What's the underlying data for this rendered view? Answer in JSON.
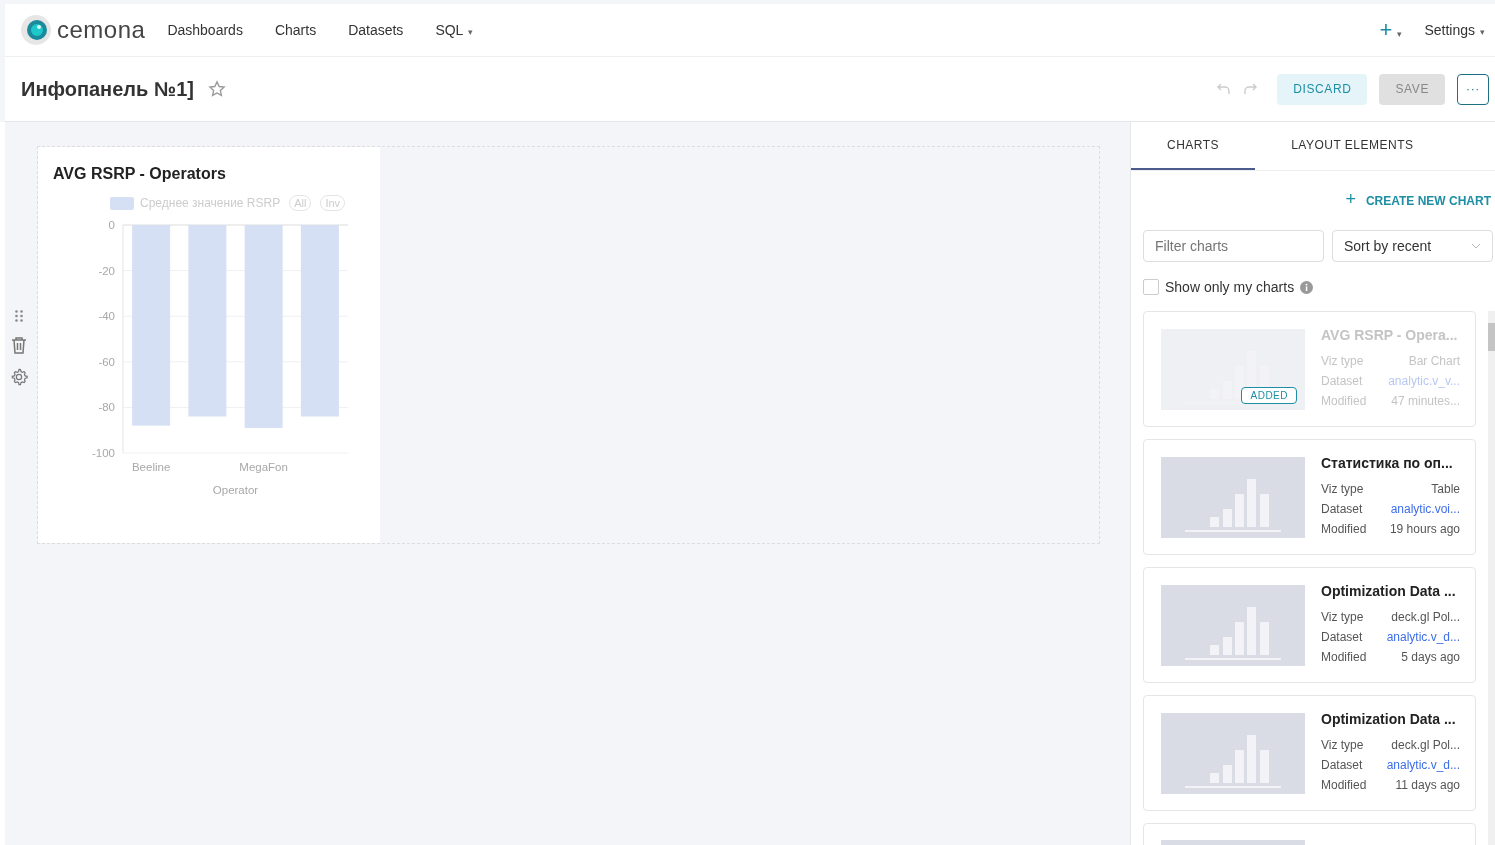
{
  "nav": {
    "brand": "cemona",
    "items": [
      {
        "label": "Dashboards"
      },
      {
        "label": "Charts"
      },
      {
        "label": "Datasets"
      },
      {
        "label": "SQL",
        "caret": "▾"
      }
    ],
    "right": [
      {
        "kind": "plus",
        "label": "+",
        "caret": "▾"
      },
      {
        "kind": "text",
        "label": "Settings",
        "caret": "▾"
      }
    ]
  },
  "header": {
    "title": "Инфопанель №1]",
    "starred": false,
    "buttons": [
      {
        "kind": "discard",
        "label": "DISCARD"
      },
      {
        "kind": "save",
        "label": "SAVE"
      },
      {
        "kind": "more",
        "label": "···"
      }
    ]
  },
  "chart_card": {
    "title": "AVG RSRP - Operators",
    "legend": {
      "label": "Среднее значение RSRP",
      "buttons": [
        "All",
        "Inv"
      ]
    },
    "chart_data": {
      "type": "bar",
      "xlabel": "Operator",
      "categories": [
        "Beeline",
        null,
        "MegaFon",
        null
      ],
      "values": [
        -88,
        -84,
        -89,
        -84
      ],
      "ylim": [
        -100,
        0
      ],
      "yticks": [
        0,
        -20,
        -40,
        -60,
        -80,
        -100
      ],
      "grid": true
    }
  },
  "panel": {
    "tabs": [
      {
        "label": "CHARTS",
        "selected": true
      },
      {
        "label": "LAYOUT ELEMENTS",
        "selected": false
      }
    ],
    "create": {
      "icon": "+",
      "label": "CREATE NEW CHART"
    },
    "filter": {
      "placeholder": "Filter charts"
    },
    "sort": {
      "value": "Sort by recent"
    },
    "only_mine": {
      "label": "Show only my charts",
      "checked": false
    },
    "cards": [
      {
        "title": "AVG RSRP - Opera...",
        "added": true,
        "badge": "ADDED",
        "fields": [
          {
            "label": "Viz type",
            "value": "Bar Chart",
            "link": false
          },
          {
            "label": "Dataset",
            "value": "analytic.v_v...",
            "link": true
          },
          {
            "label": "Modified",
            "value": "47 minutes...",
            "link": false
          }
        ]
      },
      {
        "title": "Статистика по оп...",
        "added": false,
        "fields": [
          {
            "label": "Viz type",
            "value": "Table",
            "link": false
          },
          {
            "label": "Dataset",
            "value": "analytic.voi...",
            "link": true
          },
          {
            "label": "Modified",
            "value": "19 hours ago",
            "link": false
          }
        ]
      },
      {
        "title": "Optimization Data ...",
        "added": false,
        "fields": [
          {
            "label": "Viz type",
            "value": "deck.gl Pol...",
            "link": false
          },
          {
            "label": "Dataset",
            "value": "analytic.v_d...",
            "link": true
          },
          {
            "label": "Modified",
            "value": "5 days ago",
            "link": false
          }
        ]
      },
      {
        "title": "Optimization Data ...",
        "added": false,
        "fields": [
          {
            "label": "Viz type",
            "value": "deck.gl Pol...",
            "link": false
          },
          {
            "label": "Dataset",
            "value": "analytic.v_d...",
            "link": true
          },
          {
            "label": "Modified",
            "value": "11 days ago",
            "link": false
          }
        ]
      }
    ]
  }
}
